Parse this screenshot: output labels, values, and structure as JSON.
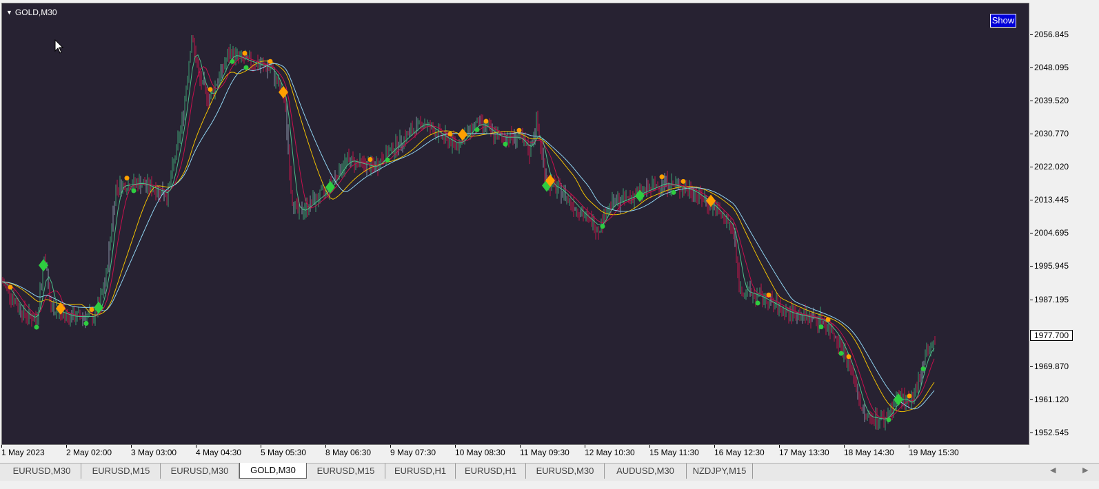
{
  "chart": {
    "symbol_title": "GOLD,M30",
    "show_button": "Show",
    "current_price": "1977.700",
    "price_scale": [
      "2056.845",
      "2048.095",
      "2039.520",
      "2030.770",
      "2022.020",
      "2013.445",
      "2004.695",
      "1995.945",
      "1987.195",
      "1969.870",
      "1961.120",
      "1952.545"
    ],
    "time_scale": [
      "1 May 2023",
      "2 May 02:00",
      "3 May 03:00",
      "4 May 04:30",
      "5 May 05:30",
      "8 May 06:30",
      "9 May 07:30",
      "10 May 08:30",
      "11 May 09:30",
      "12 May 10:30",
      "15 May 11:30",
      "16 May 12:30",
      "17 May 13:30",
      "18 May 14:30",
      "19 May 15:30"
    ],
    "colors": {
      "background": "#272232",
      "bull_candle": "#3c9f72",
      "bear_candle": "#c2164a",
      "neutral_candle": "#8a93a8",
      "slow_line": "#f0c000",
      "fast_line": "#c8104e",
      "baseline": "#8fd3f0",
      "signal_line": "#4cc08a",
      "buy_marker": "#2ecc40",
      "sell_marker": "#ffa000"
    }
  },
  "tabs": [
    {
      "label": "EURUSD,M30",
      "active": false
    },
    {
      "label": "EURUSD,M15",
      "active": false
    },
    {
      "label": "EURUSD,M30",
      "active": false
    },
    {
      "label": "GOLD,M30",
      "active": true
    },
    {
      "label": "EURUSD,M15",
      "active": false
    },
    {
      "label": "EURUSD,H1",
      "active": false
    },
    {
      "label": "EURUSD,H1",
      "active": false
    },
    {
      "label": "EURUSD,M30",
      "active": false
    },
    {
      "label": "AUDUSD,M30",
      "active": false
    },
    {
      "label": "NZDJPY,M15",
      "active": false
    }
  ],
  "icons": {
    "collapse": "triangle-down-icon",
    "cursor": "arrow-cursor-icon",
    "scroll_left": "chevron-left-icon",
    "scroll_right": "chevron-right-icon"
  }
}
